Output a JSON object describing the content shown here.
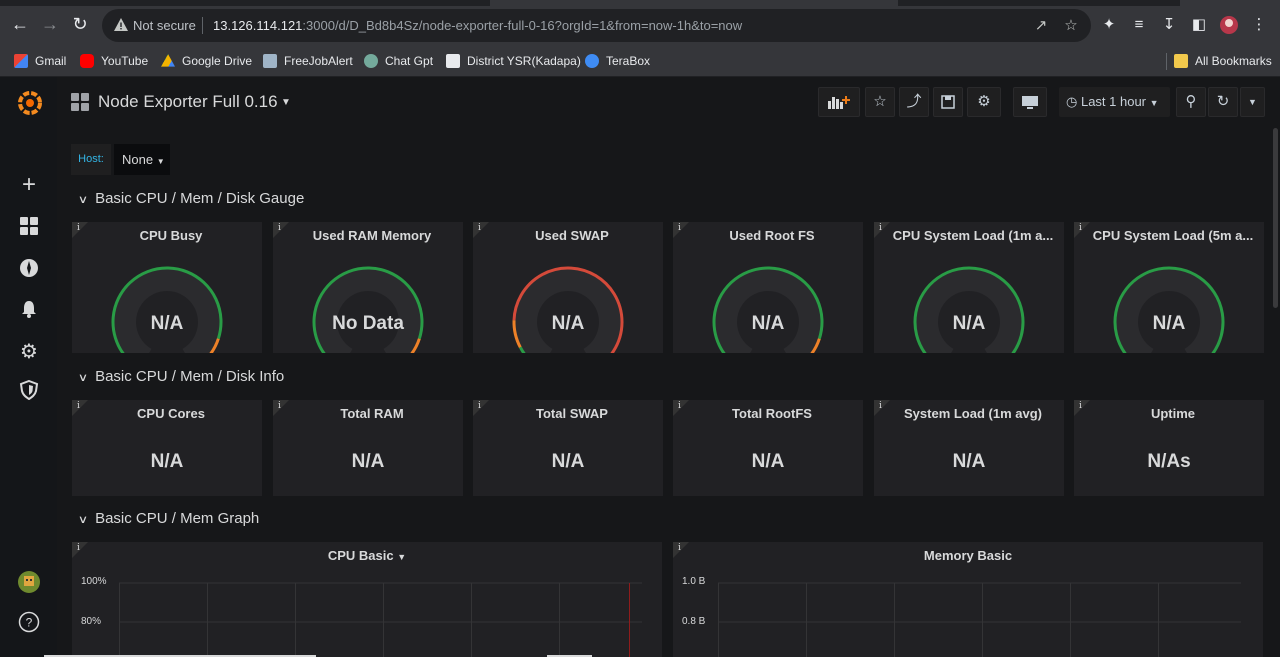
{
  "browser": {
    "security_label": "Not secure",
    "url_host": "13.126.114.121",
    "url_rest": ":3000/d/D_Bd8b4Sz/node-exporter-full-0-16?orgId=1&from=now-1h&to=now",
    "bookmarks": [
      "Gmail",
      "YouTube",
      "Google Drive",
      "FreeJobAlert",
      "Chat Gpt",
      "District YSR(Kadapa)",
      "TeraBox"
    ],
    "all_bookmarks": "All Bookmarks"
  },
  "dashboard": {
    "title": "Node Exporter Full 0.16",
    "time_range": "Last 1 hour",
    "variable": {
      "label": "Host:",
      "value": "None"
    }
  },
  "rows": [
    {
      "title": "Basic CPU / Mem / Disk Gauge",
      "panels": [
        {
          "title": "CPU Busy",
          "value": "N/A",
          "thresholds": "green-orange-red-tail"
        },
        {
          "title": "Used RAM Memory",
          "value": "No Data",
          "thresholds": "green-orange-red-tail"
        },
        {
          "title": "Used SWAP",
          "value": "N/A",
          "thresholds": "mostly-red"
        },
        {
          "title": "Used Root FS",
          "value": "N/A",
          "thresholds": "green-orange-red-tail"
        },
        {
          "title": "CPU System Load (1m a...",
          "value": "N/A",
          "thresholds": "green-orange-tail"
        },
        {
          "title": "CPU System Load (5m a...",
          "value": "N/A",
          "thresholds": "green-orange-tail"
        }
      ]
    },
    {
      "title": "Basic CPU / Mem / Disk Info",
      "panels": [
        {
          "title": "CPU Cores",
          "value": "N/A"
        },
        {
          "title": "Total RAM",
          "value": "N/A"
        },
        {
          "title": "Total SWAP",
          "value": "N/A"
        },
        {
          "title": "Total RootFS",
          "value": "N/A"
        },
        {
          "title": "System Load (1m avg)",
          "value": "N/A"
        },
        {
          "title": "Uptime",
          "value": "N/As"
        }
      ]
    },
    {
      "title": "Basic CPU / Mem Graph",
      "panels": [
        {
          "title": "CPU Basic",
          "yticks": [
            "100%",
            "80%"
          ]
        },
        {
          "title": "Memory Basic",
          "yticks": [
            "1.0 B",
            "0.8 B"
          ]
        }
      ]
    }
  ],
  "colors": {
    "green": "#299c46",
    "orange": "#ed8128",
    "red": "#d44a3a",
    "panel_bg": "#212124",
    "page_bg": "#161719"
  }
}
